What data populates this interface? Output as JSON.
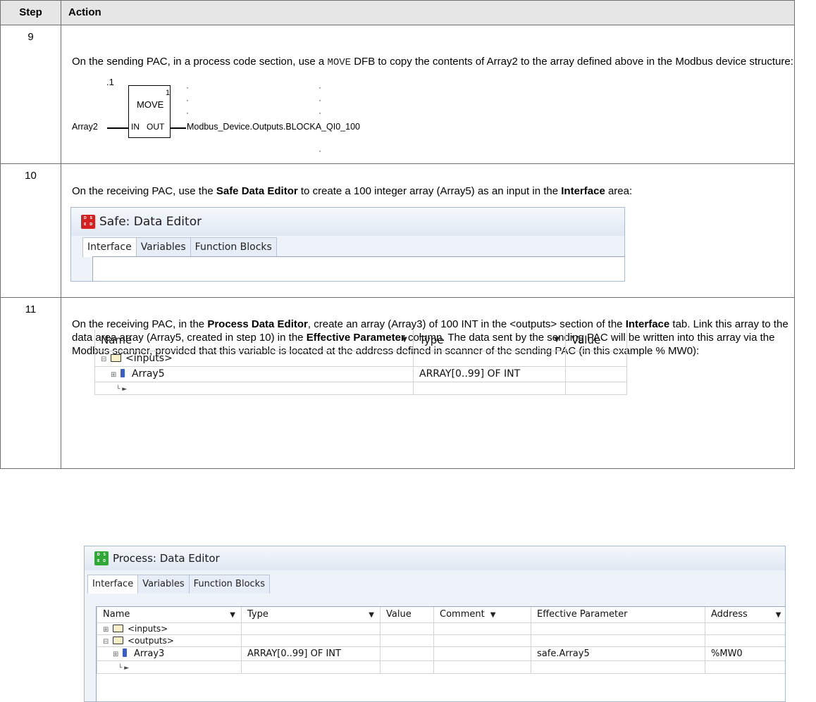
{
  "header": {
    "step": "Step",
    "action": "Action"
  },
  "rows": [
    {
      "step": "9",
      "text_before": "On the sending PAC, in a process code section, use a",
      "code": "MOVE",
      "text_after": "DFB to copy the contents of Array2 to the array defined above in the Modbus device structure:",
      "fbd": {
        "index_label": ".1",
        "block_name": "MOVE",
        "block_number": "1",
        "input_pin": "IN",
        "output_pin": "OUT",
        "input_var": "Array2",
        "output_var": "Modbus_Device.Outputs.BLOCKA_QI0_100"
      }
    },
    {
      "step": "10",
      "text_1": "On the receiving PAC, use the",
      "bold_1": "Safe Data Editor",
      "text_2": "to create a 100 integer array (Array5) as an input in the",
      "bold_2": "Interface",
      "text_3": "area:",
      "editor": {
        "title": "Safe: Data Editor",
        "icon_letters": [
          "D",
          "S",
          "E",
          "D"
        ],
        "icon_color": "#d42020",
        "tabs": [
          "Interface",
          "Variables",
          "Function Blocks"
        ],
        "columns": [
          "Name",
          "Type",
          "Value"
        ],
        "rows": [
          {
            "name": "<inputs>",
            "type": ""
          },
          {
            "name": "Array5",
            "type": "ARRAY[0..99] OF INT"
          }
        ]
      }
    },
    {
      "step": "11",
      "t1": "On the receiving PAC, in the",
      "b1": "Process Data Editor",
      "t2": ", create an array (Array3) of 100 INT in the <outputs> section of the",
      "b2": "Interface",
      "t3": "tab. Link this array to the data area array (Array5, created in step 10) in the",
      "b3": "Effective Parameter",
      "t4": "column. The data sent by the sending PAC will be written into this array via the Modbus scanner, provided that this variable is located at the address defined in scanner of the sending PAC (in this example % MW0):",
      "editor": {
        "title": "Process: Data Editor",
        "icon_letters": [
          "D",
          "S",
          "E",
          "D"
        ],
        "icon_color": "#2fa836",
        "tabs": [
          "Interface",
          "Variables",
          "Function Blocks"
        ],
        "columns": [
          "Name",
          "Type",
          "Value",
          "Comment",
          "Effective Parameter",
          "Address"
        ],
        "rows": [
          {
            "name": "<inputs>",
            "type": "",
            "effective": "",
            "address": ""
          },
          {
            "name": "<outputs>",
            "type": "",
            "effective": "",
            "address": ""
          },
          {
            "name": "Array3",
            "type": "ARRAY[0..99] OF INT",
            "effective": "safe.Array5",
            "address": "%MW0"
          }
        ]
      }
    }
  ]
}
